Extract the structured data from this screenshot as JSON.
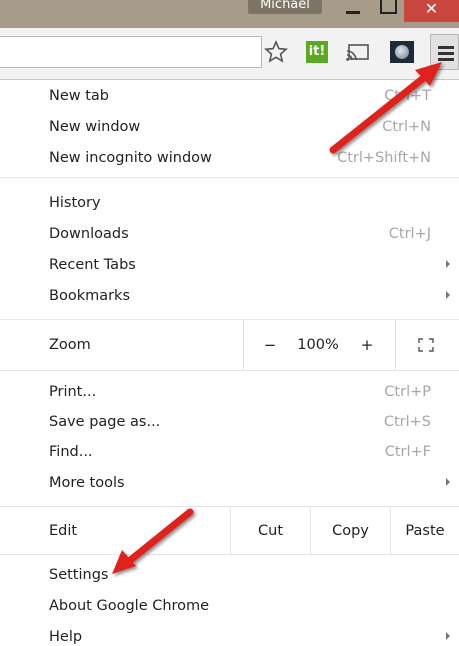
{
  "titlebar": {
    "profile_name": "Michael",
    "close_glyph": "✕"
  },
  "toolbar": {
    "itl_label": "it!"
  },
  "menu": {
    "group1": [
      {
        "label": "New tab",
        "shortcut": "Ctrl+T"
      },
      {
        "label": "New window",
        "shortcut": "Ctrl+N"
      },
      {
        "label": "New incognito window",
        "shortcut": "Ctrl+Shift+N"
      }
    ],
    "group2": [
      {
        "label": "History",
        "shortcut": ""
      },
      {
        "label": "Downloads",
        "shortcut": "Ctrl+J"
      },
      {
        "label": "Recent Tabs",
        "shortcut": ""
      },
      {
        "label": "Bookmarks",
        "shortcut": ""
      }
    ],
    "zoom": {
      "label": "Zoom",
      "minus": "−",
      "value": "100%",
      "plus": "+"
    },
    "group3": [
      {
        "label": "Print...",
        "shortcut": "Ctrl+P"
      },
      {
        "label": "Save page as...",
        "shortcut": "Ctrl+S"
      },
      {
        "label": "Find...",
        "shortcut": "Ctrl+F"
      },
      {
        "label": "More tools",
        "shortcut": ""
      }
    ],
    "edit": {
      "label": "Edit",
      "cut": "Cut",
      "copy": "Copy",
      "paste": "Paste"
    },
    "group4": [
      {
        "label": "Settings"
      },
      {
        "label": "About Google Chrome"
      },
      {
        "label": "Help"
      }
    ]
  },
  "colors": {
    "arrow": "#e0241b",
    "titlebar": "#a79c89",
    "close_button": "#c9463d",
    "shortcut_text": "#a7a7a7"
  }
}
